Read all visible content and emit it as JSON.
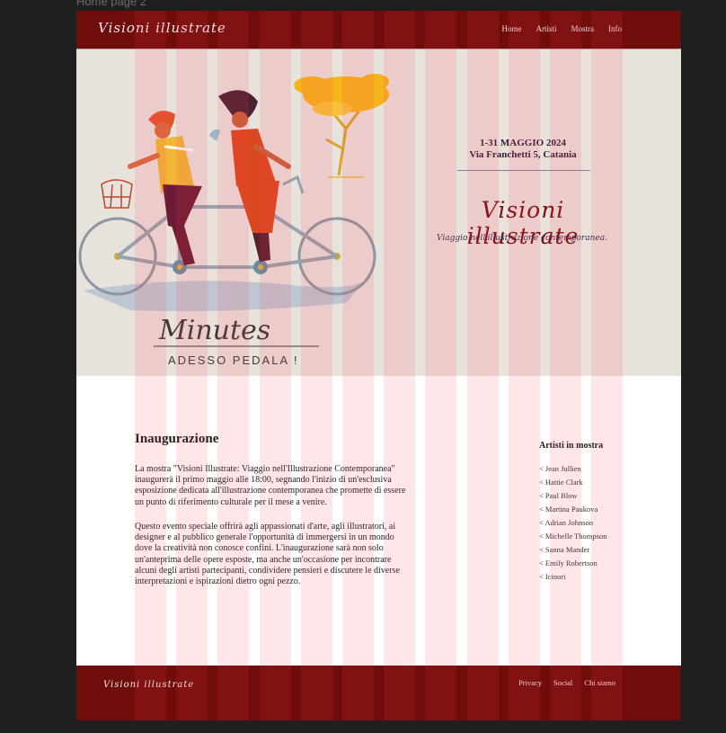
{
  "canvas": {
    "frame_label": "Home page 2"
  },
  "header": {
    "logo": "Visioni illustrate",
    "nav": [
      "Home",
      "Artisti",
      "Mostra",
      "Info"
    ]
  },
  "hero": {
    "date_line1": "1-31 MAGGIO 2024",
    "date_line2": "Via Franchetti 5, Catania",
    "title": "Visioni illustrate",
    "subtitle": "Viaggio nell'illustrazione contemporanea.",
    "illustration": {
      "caption": "Minutes",
      "tagline": "ADESSO PEDALA !"
    }
  },
  "main": {
    "heading": "Inaugurazione",
    "paragraph1": "La mostra \"Visioni Illustrate: Viaggio nell'Illustrazione Contemporanea\" inaugurerà il primo maggio alle 18:00, segnando l'inizio di un'esclusiva esposizione dedicata all'illustrazione contemporanea che promette di essere un punto di riferimento culturale per il mese a venire.",
    "paragraph2": "Questo evento speciale offrirà agli appassionati d'arte, agli illustratori, ai designer e al pubblico generale l'opportunità di immergersi in un mondo dove la creatività non conosce confini. L'inaugurazione sarà non solo un'anteprima delle opere esposte, ma anche un'occasione per incontrare alcuni degli artisti partecipanti, condividere pensieri e discutere le diverse interpretazioni e ispirazioni dietro ogni pezzo."
  },
  "aside": {
    "title": "Artisti in mostra",
    "artists": [
      "< Jean Jullien",
      "< Hattie Clark",
      "< Paul Blow",
      "< Martina Paukova",
      "< Adrian Johnson",
      "< Michelle Thompson",
      "< Sanna Mander",
      "< Emily Robertson",
      "< Icinori"
    ]
  },
  "footer": {
    "logo": "Visioni illustrate",
    "links": [
      "Privacy",
      "Social",
      "Chi siamo"
    ]
  },
  "colors": {
    "brand": "#6f0c0c",
    "hero_bg": "#e8e2dd",
    "title_red": "#7a0f12",
    "grid_overlay": "rgba(255,60,80,0.13)",
    "canvas_bg": "#1f1f1f"
  },
  "grid_overlay": {
    "columns": 12
  }
}
